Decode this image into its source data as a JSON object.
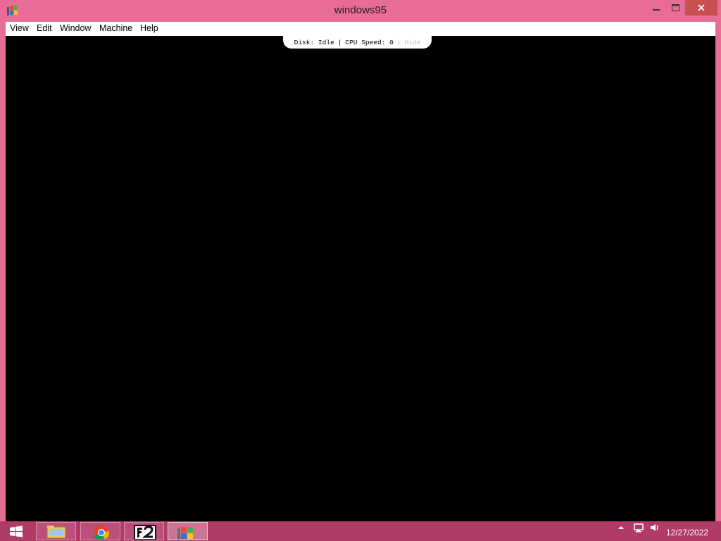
{
  "window": {
    "title": "windows95",
    "app_icon": "windows95-app-icon",
    "frame_color": "#e96b97",
    "close_button_color": "#c75050"
  },
  "menubar": {
    "items": [
      {
        "label": "View"
      },
      {
        "label": "Edit"
      },
      {
        "label": "Window"
      },
      {
        "label": "Machine"
      },
      {
        "label": "Help"
      }
    ]
  },
  "status": {
    "disk_label": "Disk:",
    "disk_value": "Idle",
    "cpu_label": "CPU Speed:",
    "cpu_value": "0",
    "hide_label": "Hide"
  },
  "taskbar": {
    "background": "#b23a68",
    "start_icon": "windows-start-icon",
    "apps": [
      {
        "name": "file-explorer-icon"
      },
      {
        "name": "chrome-icon"
      },
      {
        "name": "f2-app-icon"
      },
      {
        "name": "windows95-app-icon",
        "active": true
      }
    ],
    "tray": [
      "tray-arrow-icon",
      "network-icon",
      "volume-icon"
    ],
    "clock": "12/27/2022"
  }
}
